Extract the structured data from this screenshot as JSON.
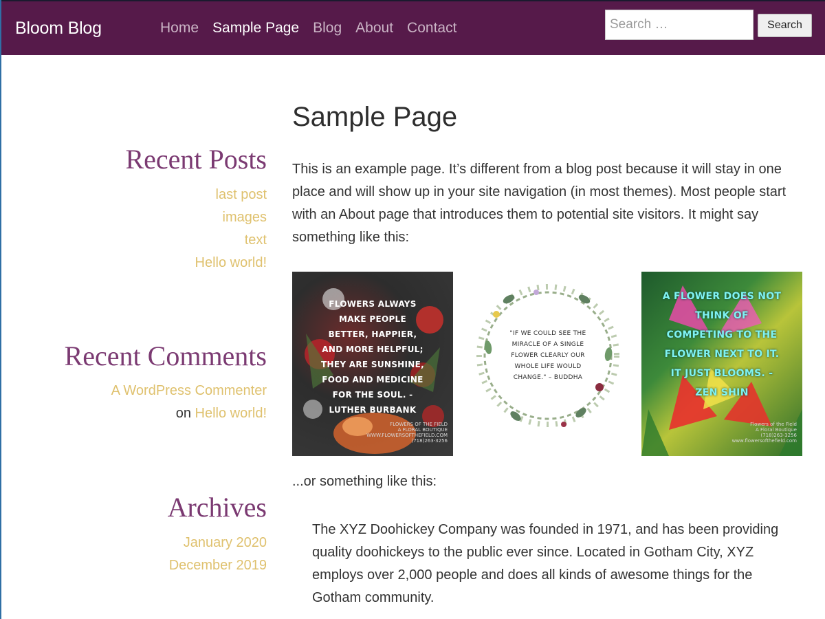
{
  "header": {
    "brand": "Bloom Blog",
    "nav": [
      {
        "label": "Home",
        "active": false
      },
      {
        "label": "Sample Page",
        "active": true
      },
      {
        "label": "Blog",
        "active": false
      },
      {
        "label": "About",
        "active": false
      },
      {
        "label": "Contact",
        "active": false
      }
    ],
    "search_placeholder": "Search …",
    "search_button": "Search"
  },
  "sidebar": {
    "recent_posts": {
      "title": "Recent Posts",
      "items": [
        "last post",
        "images",
        "text",
        "Hello world!"
      ]
    },
    "recent_comments": {
      "title": "Recent Comments",
      "author": "A WordPress Commenter",
      "on": "on",
      "post": "Hello world!"
    },
    "archives": {
      "title": "Archives",
      "items": [
        "January 2020",
        "December 2019"
      ]
    }
  },
  "main": {
    "title": "Sample Page",
    "intro": "This is an example page. It’s different from a blog post because it will stay in one place and will show up in your site navigation (in most themes). Most people start with an About page that introduces them to potential site visitors. It might say something like this:",
    "images": [
      {
        "quote": "FLOWERS ALWAYS MAKE PEOPLE BETTER, HAPPIER, AND MORE HELPFUL; THEY ARE SUNSHINE, FOOD AND MEDICINE FOR THE SOUL. - LUTHER BURBANK",
        "fine_print": "FLOWERS OF THE FIELD\nA FLORAL BOUTIQUE\nWWW.FLOWERSOFTHEFIELD.COM\n(718)263-3256"
      },
      {
        "quote": "\"IF WE COULD SEE THE MIRACLE OF A SINGLE FLOWER CLEARLY OUR WHOLE LIFE WOULD CHANGE.\" – BUDDHA"
      },
      {
        "quote": "A FLOWER DOES NOT THINK OF COMPETING TO THE FLOWER NEXT TO IT. IT JUST BLOOMS. - ZEN SHIN",
        "fine_print": "Flowers of the Field\nA Floral Boutique\n(718)263-3256\nwww.flowersofthefield.com"
      }
    ],
    "caption": "...or something like this:",
    "blockquote": "The XYZ Doohickey Company was founded in 1971, and has been providing quality doohickeys to the public ever since. Located in Gotham City, XYZ employs over 2,000 people and does all kinds of awesome things for the Gotham community."
  },
  "colors": {
    "header_bg": "#561a4a",
    "widget_title": "#7b3a72",
    "link_gold": "#dfc16e",
    "nav_inactive": "#cbb5c6"
  }
}
